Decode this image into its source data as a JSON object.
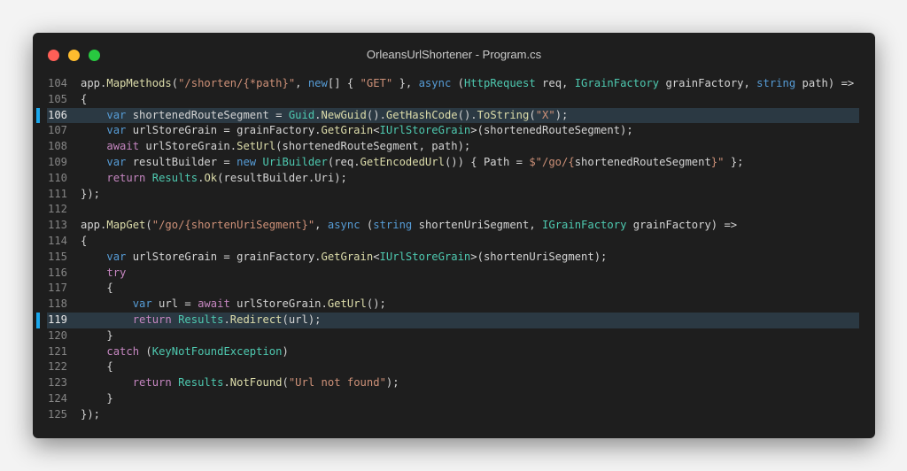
{
  "window": {
    "title": "OrleansUrlShortener - Program.cs"
  },
  "code": {
    "lines": [
      {
        "n": "104",
        "hl": false,
        "tokens": [
          [
            "app.",
            "p"
          ],
          [
            "MapMethods",
            "f"
          ],
          [
            "(",
            "p"
          ],
          [
            "\"/shorten/{*path}\"",
            "s"
          ],
          [
            ", ",
            "p"
          ],
          [
            "new",
            "k"
          ],
          [
            "[] { ",
            "p"
          ],
          [
            "\"GET\"",
            "s"
          ],
          [
            " }, ",
            "p"
          ],
          [
            "async",
            "k"
          ],
          [
            " (",
            "p"
          ],
          [
            "HttpRequest",
            "ty"
          ],
          [
            " req, ",
            "p"
          ],
          [
            "IGrainFactory",
            "ty"
          ],
          [
            " grainFactory, ",
            "p"
          ],
          [
            "string",
            "k"
          ],
          [
            " path) =>",
            "p"
          ]
        ]
      },
      {
        "n": "105",
        "hl": false,
        "tokens": [
          [
            "{",
            "p"
          ]
        ]
      },
      {
        "n": "106",
        "hl": true,
        "tokens": [
          [
            "    ",
            "p"
          ],
          [
            "var",
            "k"
          ],
          [
            " shortenedRouteSegment = ",
            "p"
          ],
          [
            "Guid",
            "ty"
          ],
          [
            ".",
            "p"
          ],
          [
            "NewGuid",
            "f"
          ],
          [
            "().",
            "p"
          ],
          [
            "GetHashCode",
            "f"
          ],
          [
            "().",
            "p"
          ],
          [
            "ToString",
            "f"
          ],
          [
            "(",
            "p"
          ],
          [
            "\"X\"",
            "s"
          ],
          [
            ");",
            "p"
          ]
        ]
      },
      {
        "n": "107",
        "hl": false,
        "tokens": [
          [
            "    ",
            "p"
          ],
          [
            "var",
            "k"
          ],
          [
            " urlStoreGrain = grainFactory.",
            "p"
          ],
          [
            "GetGrain",
            "f"
          ],
          [
            "<",
            "p"
          ],
          [
            "IUrlStoreGrain",
            "ty"
          ],
          [
            ">(shortenedRouteSegment);",
            "p"
          ]
        ]
      },
      {
        "n": "108",
        "hl": false,
        "tokens": [
          [
            "    ",
            "p"
          ],
          [
            "await",
            "c"
          ],
          [
            " urlStoreGrain.",
            "p"
          ],
          [
            "SetUrl",
            "f"
          ],
          [
            "(shortenedRouteSegment, path);",
            "p"
          ]
        ]
      },
      {
        "n": "109",
        "hl": false,
        "tokens": [
          [
            "    ",
            "p"
          ],
          [
            "var",
            "k"
          ],
          [
            " resultBuilder = ",
            "p"
          ],
          [
            "new",
            "k"
          ],
          [
            " ",
            "p"
          ],
          [
            "UriBuilder",
            "ty"
          ],
          [
            "(req.",
            "p"
          ],
          [
            "GetEncodedUrl",
            "f"
          ],
          [
            "()) { Path = ",
            "p"
          ],
          [
            "$\"/go/{",
            "s"
          ],
          [
            "shortenedRouteSegment",
            "p"
          ],
          [
            "}\"",
            "s"
          ],
          [
            " };",
            "p"
          ]
        ]
      },
      {
        "n": "110",
        "hl": false,
        "tokens": [
          [
            "    ",
            "p"
          ],
          [
            "return",
            "c"
          ],
          [
            " ",
            "p"
          ],
          [
            "Results",
            "ty"
          ],
          [
            ".",
            "p"
          ],
          [
            "Ok",
            "f"
          ],
          [
            "(resultBuilder.Uri);",
            "p"
          ]
        ]
      },
      {
        "n": "111",
        "hl": false,
        "tokens": [
          [
            "});",
            "p"
          ]
        ]
      },
      {
        "n": "112",
        "hl": false,
        "tokens": []
      },
      {
        "n": "113",
        "hl": false,
        "tokens": [
          [
            "app.",
            "p"
          ],
          [
            "MapGet",
            "f"
          ],
          [
            "(",
            "p"
          ],
          [
            "\"/go/{shortenUriSegment}\"",
            "s"
          ],
          [
            ", ",
            "p"
          ],
          [
            "async",
            "k"
          ],
          [
            " (",
            "p"
          ],
          [
            "string",
            "k"
          ],
          [
            " shortenUriSegment, ",
            "p"
          ],
          [
            "IGrainFactory",
            "ty"
          ],
          [
            " grainFactory) =>",
            "p"
          ]
        ]
      },
      {
        "n": "114",
        "hl": false,
        "tokens": [
          [
            "{",
            "p"
          ]
        ]
      },
      {
        "n": "115",
        "hl": false,
        "tokens": [
          [
            "    ",
            "p"
          ],
          [
            "var",
            "k"
          ],
          [
            " urlStoreGrain = grainFactory.",
            "p"
          ],
          [
            "GetGrain",
            "f"
          ],
          [
            "<",
            "p"
          ],
          [
            "IUrlStoreGrain",
            "ty"
          ],
          [
            ">(shortenUriSegment);",
            "p"
          ]
        ]
      },
      {
        "n": "116",
        "hl": false,
        "tokens": [
          [
            "    ",
            "p"
          ],
          [
            "try",
            "c"
          ]
        ]
      },
      {
        "n": "117",
        "hl": false,
        "tokens": [
          [
            "    {",
            "p"
          ]
        ]
      },
      {
        "n": "118",
        "hl": false,
        "tokens": [
          [
            "        ",
            "p"
          ],
          [
            "var",
            "k"
          ],
          [
            " url = ",
            "p"
          ],
          [
            "await",
            "c"
          ],
          [
            " urlStoreGrain.",
            "p"
          ],
          [
            "GetUrl",
            "f"
          ],
          [
            "();",
            "p"
          ]
        ]
      },
      {
        "n": "119",
        "hl": true,
        "tokens": [
          [
            "        ",
            "p"
          ],
          [
            "return",
            "c"
          ],
          [
            " ",
            "p"
          ],
          [
            "Results",
            "ty"
          ],
          [
            ".",
            "p"
          ],
          [
            "Redirect",
            "f"
          ],
          [
            "(url);",
            "p"
          ]
        ]
      },
      {
        "n": "120",
        "hl": false,
        "tokens": [
          [
            "    }",
            "p"
          ]
        ]
      },
      {
        "n": "121",
        "hl": false,
        "tokens": [
          [
            "    ",
            "p"
          ],
          [
            "catch",
            "c"
          ],
          [
            " (",
            "p"
          ],
          [
            "KeyNotFoundException",
            "ty"
          ],
          [
            ")",
            "p"
          ]
        ]
      },
      {
        "n": "122",
        "hl": false,
        "tokens": [
          [
            "    {",
            "p"
          ]
        ]
      },
      {
        "n": "123",
        "hl": false,
        "tokens": [
          [
            "        ",
            "p"
          ],
          [
            "return",
            "c"
          ],
          [
            " ",
            "p"
          ],
          [
            "Results",
            "ty"
          ],
          [
            ".",
            "p"
          ],
          [
            "NotFound",
            "f"
          ],
          [
            "(",
            "p"
          ],
          [
            "\"Url not found\"",
            "s"
          ],
          [
            ");",
            "p"
          ]
        ]
      },
      {
        "n": "124",
        "hl": false,
        "tokens": [
          [
            "    }",
            "p"
          ]
        ]
      },
      {
        "n": "125",
        "hl": false,
        "tokens": [
          [
            "});",
            "p"
          ]
        ]
      }
    ]
  },
  "colors": {
    "background": "#f3f3f3",
    "window": "#1e1e1e",
    "highlight_line": "#2b3943",
    "gutter_marker": "#1aa7ec",
    "traffic_red": "#ff5f57",
    "traffic_yellow": "#febc2e",
    "traffic_green": "#28c840"
  }
}
